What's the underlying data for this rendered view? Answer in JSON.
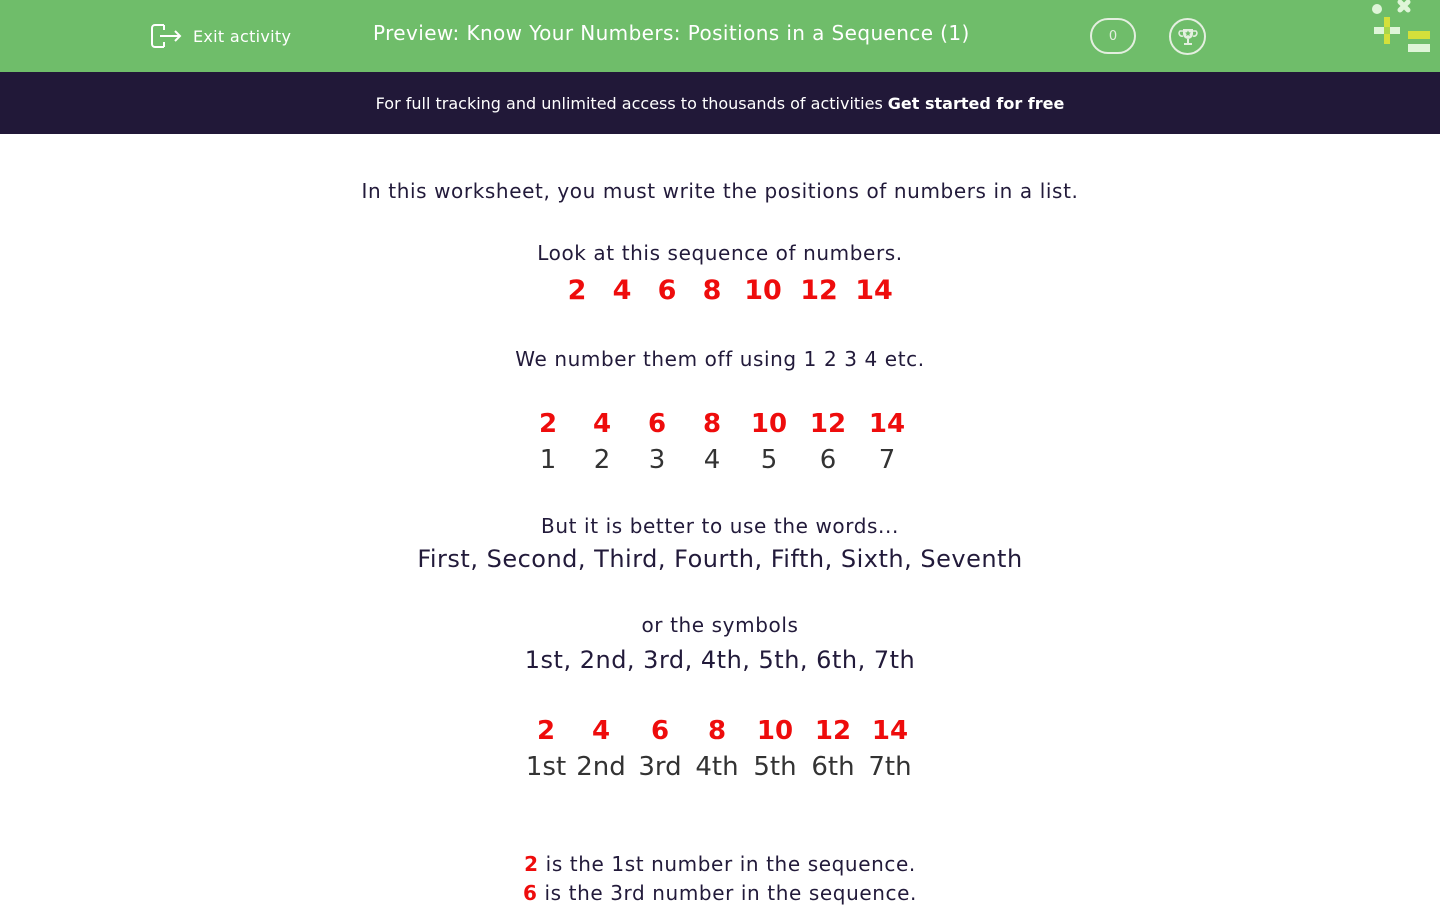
{
  "header": {
    "exit_label": "Exit activity",
    "title": "Preview: Know Your Numbers: Positions in a Sequence (1)",
    "score": "0",
    "icons": {
      "exit": "exit-door-arrow-icon",
      "trophy": "trophy-icon",
      "logo": "maths-symbols-logo"
    },
    "colors": {
      "bar": "#6fbd6a",
      "banner": "#211838"
    }
  },
  "banner": {
    "text": "For full tracking and unlimited access to thousands of activities",
    "cta": "Get started for free"
  },
  "content": {
    "intro": "In this worksheet, you must write the positions of numbers in a list.",
    "look": "Look at this sequence of numbers.",
    "sequence": [
      "2",
      "4",
      "6",
      "8",
      "10",
      "12",
      "14"
    ],
    "number_off": "We number them off using 1 2 3 4 etc.",
    "table1": {
      "numbers": [
        "2",
        "4",
        "6",
        "8",
        "10",
        "12",
        "14"
      ],
      "positions": [
        "1",
        "2",
        "3",
        "4",
        "5",
        "6",
        "7"
      ]
    },
    "better": "But it is better to use the words...",
    "words": "First, Second, Third, Fourth, Fifth, Sixth, Seventh",
    "or_symbols": "or the symbols",
    "symbols": "1st, 2nd, 3rd, 4th, 5th, 6th, 7th",
    "table2": {
      "numbers": [
        "2",
        "4",
        "6",
        "8",
        "10",
        "12",
        "14"
      ],
      "positions": [
        "1st",
        "2nd",
        "3rd",
        "4th",
        "5th",
        "6th",
        "7th"
      ]
    },
    "examples": [
      {
        "number": "2",
        "text": "is the 1st number in the sequence."
      },
      {
        "number": "6",
        "text": "is the 3rd number in the sequence."
      }
    ],
    "accent_color": "#ee0c0c"
  }
}
